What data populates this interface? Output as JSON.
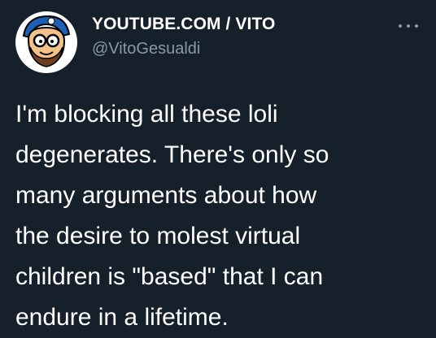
{
  "author": {
    "display_name": "YOUTUBE.COM / VITO",
    "handle": "@VitoGesualdi",
    "avatar_icon": "cartoon-avatar-with-glasses-and-cap"
  },
  "menu": {
    "more_icon": "more-horizontal-icon"
  },
  "tweet": {
    "lines": [
      "I'm blocking all these loli",
      "degenerates. There's only so",
      "many arguments about how",
      "the desire to molest virtual",
      "children is \"based\" that I can",
      "endure in a lifetime."
    ]
  },
  "colors": {
    "background": "#15202b",
    "text_primary": "#ffffff",
    "text_secondary": "#8899a6"
  }
}
